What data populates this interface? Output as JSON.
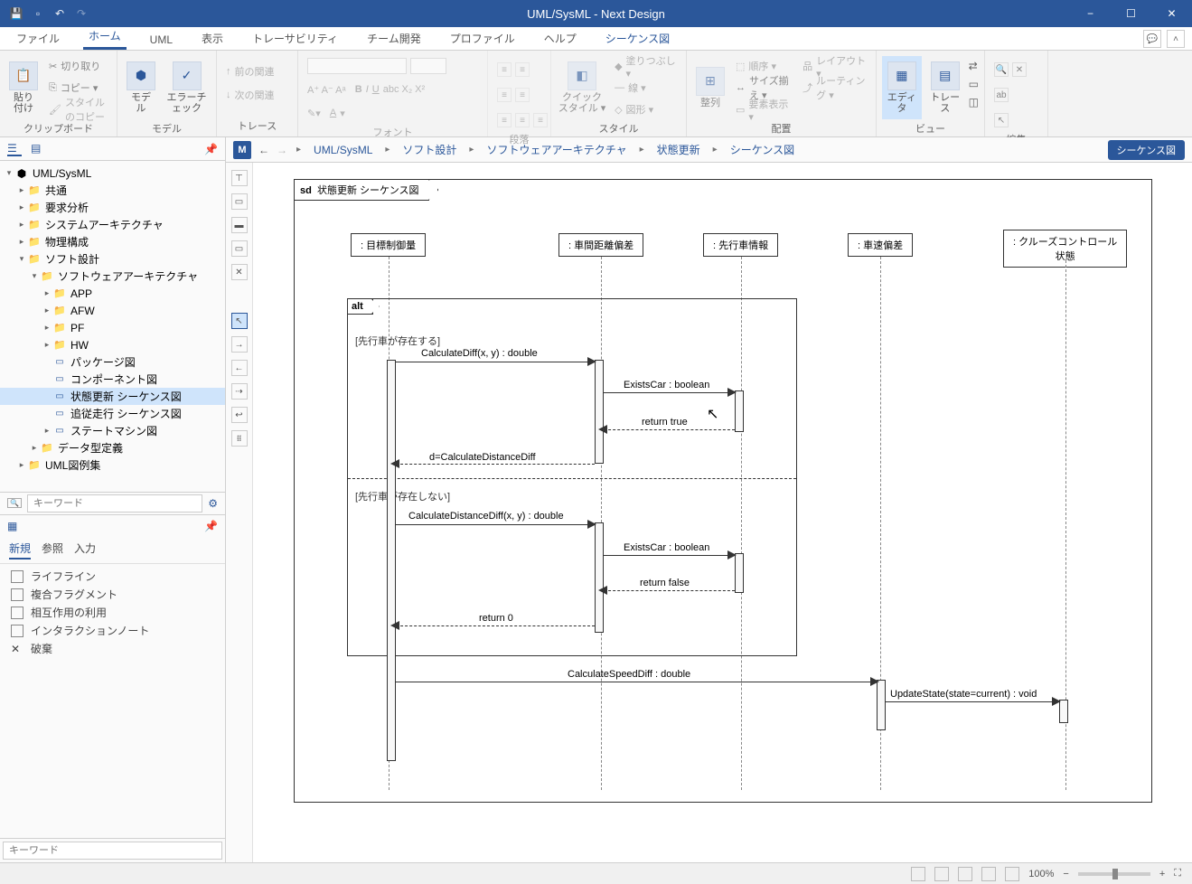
{
  "app_title": "UML/SysML - Next Design",
  "main_tabs": {
    "file": "ファイル",
    "home": "ホーム",
    "uml": "UML",
    "view": "表示",
    "trace": "トレーサビリティ",
    "team": "チーム開発",
    "profile": "プロファイル",
    "help": "ヘルプ",
    "seq": "シーケンス図"
  },
  "ribbon": {
    "clipboard": {
      "paste": "貼り付け",
      "cut": "切り取り",
      "copy": "コピー ▾",
      "styles": "スタイルのコピー",
      "label": "クリップボード"
    },
    "model": {
      "model": "モデル",
      "errcheck": "エラーチェック",
      "label": "モデル"
    },
    "trace": {
      "prev": "前の関連",
      "next": "次の関連",
      "label": "トレース"
    },
    "font": {
      "label": "フォント"
    },
    "para": {
      "label": "段落"
    },
    "style": {
      "quick": "クイック\nスタイル ▾",
      "fill": "塗りつぶし ▾",
      "line": "線 ▾",
      "shape": "図形 ▾",
      "label": "スタイル"
    },
    "arrange": {
      "align": "整列",
      "order": "順序 ▾",
      "size": "サイズ揃え ▾",
      "elem": "要素表示 ▾",
      "layout": "レイアウト ▾",
      "routing": "ルーティング ▾",
      "label": "配置"
    },
    "viewg": {
      "editor": "エディタ",
      "traceb": "トレース",
      "label": "ビュー"
    },
    "edit": {
      "label": "編集"
    }
  },
  "tree": {
    "root": "UML/SysML",
    "n1": "共通",
    "n2": "要求分析",
    "n3": "システムアーキテクチャ",
    "n4": "物理構成",
    "soft": "ソフト設計",
    "arch": "ソフトウェアアーキテクチャ",
    "app": "APP",
    "afw": "AFW",
    "pf": "PF",
    "hw": "HW",
    "pkg": "パッケージ図",
    "comp": "コンポーネント図",
    "seq1": "状態更新 シーケンス図",
    "seq2": "追従走行 シーケンス図",
    "state": "ステートマシン図",
    "type": "データ型定義",
    "umlex": "UML図例集"
  },
  "search_placeholder": "キーワード",
  "bottombox": {
    "tabs": {
      "new": "新規",
      "ref": "参照",
      "input": "入力"
    },
    "items": {
      "lifeline": "ライフライン",
      "combined": "複合フラグメント",
      "interaction": "相互作用の利用",
      "note": "インタラクションノート",
      "destroy": "破棄"
    }
  },
  "keyword_placeholder": "キーワード",
  "breadcrumb": {
    "b1": "UML/SysML",
    "b2": "ソフト設計",
    "b3": "ソフトウェアアーキテクチャ",
    "b4": "状態更新",
    "b5": "シーケンス図",
    "chip": "シーケンス図"
  },
  "diagram": {
    "title_prefix": "sd",
    "title": "状態更新 シーケンス図",
    "ll1": ": 目標制御量",
    "ll2": ": 車間距離偏差",
    "ll3": ": 先行車情報",
    "ll4": ": 車速偏差",
    "ll5": ": クルーズコントロール\n状態",
    "alt": "alt",
    "guard1": "[先行車が存在する]",
    "guard2": "[先行車が存在しない]",
    "m1": "CalculateDiff(x, y) : double",
    "m2": "ExistsCar : boolean",
    "m3": "return true",
    "m4": "d=CalculateDistanceDiff",
    "m5": "CalculateDistanceDiff(x, y) : double",
    "m6": "ExistsCar : boolean",
    "m7": "return false",
    "m8": "return 0",
    "m9": "CalculateSpeedDiff : double",
    "m10": "UpdateState(state=current) : void"
  },
  "status": {
    "zoom": "100%"
  }
}
